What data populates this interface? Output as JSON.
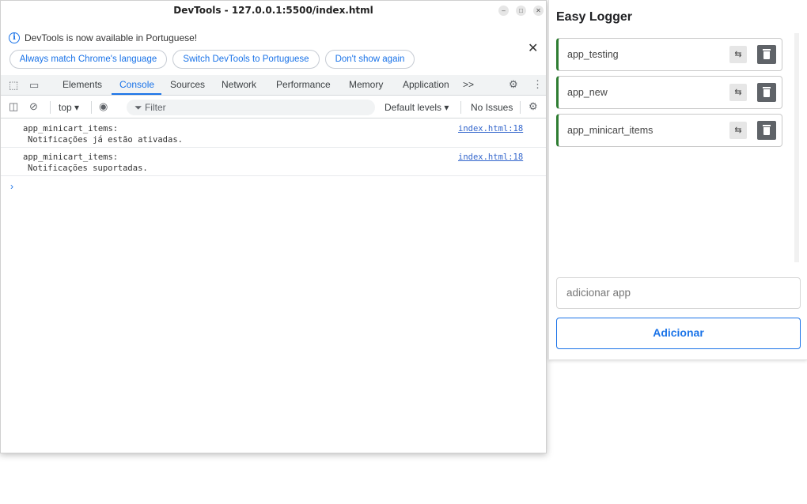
{
  "devtools": {
    "window_title": "DevTools - 127.0.0.1:5500/index.html",
    "infobar": {
      "message": "DevTools is now available in Portuguese!",
      "buttons": [
        "Always match Chrome's language",
        "Switch DevTools to Portuguese",
        "Don't show again"
      ]
    },
    "tabs": [
      "Elements",
      "Console",
      "Sources",
      "Network",
      "Performance",
      "Memory",
      "Application"
    ],
    "active_tab": "Console",
    "more_tabs": ">>",
    "filterbar": {
      "context": "top",
      "filter_placeholder": "Filter",
      "levels": "Default levels",
      "issues": "No Issues"
    },
    "console_messages": [
      {
        "line1": "app_minicart_items:",
        "line2": "Notificações já estão ativadas.",
        "source": "index.html:18"
      },
      {
        "line1": "app_minicart_items:",
        "line2": "Notificações suportadas.",
        "source": "index.html:18"
      }
    ],
    "prompt": "›"
  },
  "easy_logger": {
    "title": "Easy Logger",
    "apps": [
      {
        "name": "app_testing"
      },
      {
        "name": "app_new"
      },
      {
        "name": "app_minicart_items"
      }
    ],
    "input_placeholder": "adicionar app",
    "add_button": "Adicionar",
    "accent_color": "#1a73e8",
    "card_border_color": "#2e7d32"
  }
}
